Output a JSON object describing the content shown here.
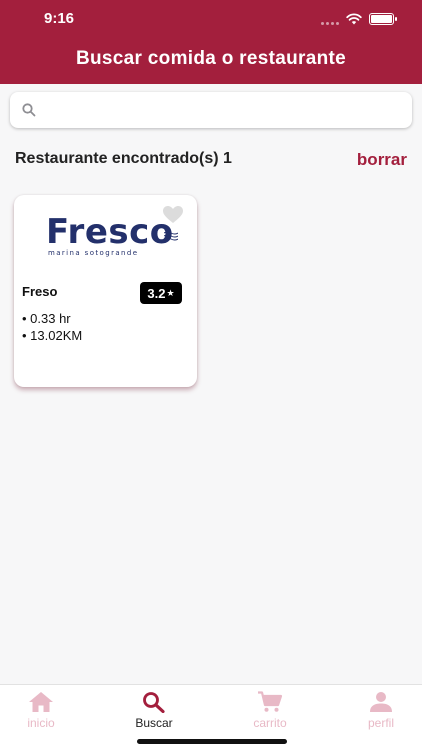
{
  "status_bar": {
    "time": "9:16"
  },
  "header": {
    "title": "Buscar comida o restaurante"
  },
  "search": {
    "value": "",
    "placeholder": ""
  },
  "results": {
    "label": "Restaurante encontrado(s) 1",
    "clear_label": "borrar"
  },
  "restaurants": [
    {
      "logo_text": "Fresco",
      "logo_subtext": "marina sotogrande",
      "name": "Freso",
      "rating": "3.2",
      "rating_icon": "star-icon",
      "details": [
        "• 0.33 hr",
        "• 13.02KM"
      ],
      "favorite_icon": "heart-icon"
    }
  ],
  "nav": {
    "items": [
      {
        "label": "inicio",
        "icon": "home-icon",
        "active": false
      },
      {
        "label": "Buscar",
        "icon": "search-icon",
        "active": true
      },
      {
        "label": "carrito",
        "icon": "cart-icon",
        "active": false
      },
      {
        "label": "perfil",
        "icon": "user-icon",
        "active": false
      }
    ]
  },
  "colors": {
    "brand": "#a31f3d",
    "inactive_nav": "#e8b9c6",
    "logo": "#23306b"
  }
}
